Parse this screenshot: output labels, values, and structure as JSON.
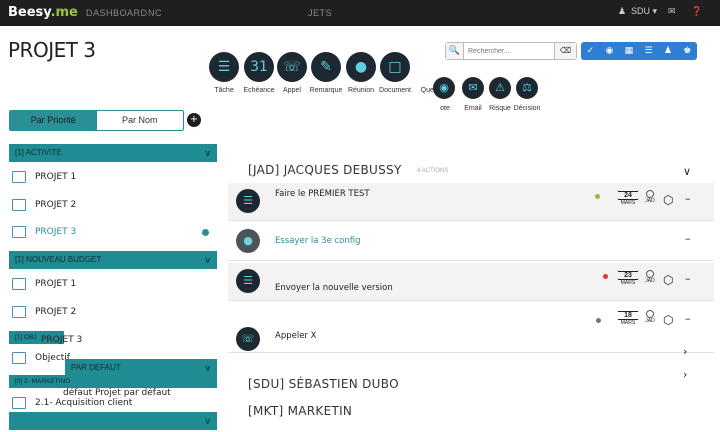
{
  "app": {
    "logo_text": "Beesy",
    "logo_suffix": ".me",
    "nav": [
      "DASHBOARD",
      "NC",
      "JETS"
    ],
    "user": "SDU ▾"
  },
  "page": {
    "title": "PROJET 3"
  },
  "search": {
    "placeholder": "Rechercher..."
  },
  "tools": {
    "top": [
      {
        "label": "Tâche",
        "icon": "task-icon"
      },
      {
        "label": "Echéance",
        "icon": "deadline-icon"
      },
      {
        "label": "Appel",
        "icon": "phone-icon"
      },
      {
        "label": "Remarque",
        "icon": "note-icon"
      },
      {
        "label": "Réunion",
        "icon": "meeting-icon"
      },
      {
        "label": "Document",
        "icon": "document-icon"
      },
      {
        "label": "Ques",
        "icon": "question-icon"
      }
    ],
    "bottom": [
      {
        "label": "ote",
        "icon": "camera-icon"
      },
      {
        "label": "Email",
        "icon": "email-icon"
      },
      {
        "label": "Risque",
        "icon": "risk-icon"
      },
      {
        "label": "Décision",
        "icon": "decision-icon"
      }
    ]
  },
  "sidebar": {
    "toggle": {
      "left": "Par Priorité",
      "right": "Par Nom"
    },
    "groups": [
      {
        "label": "[1] ACTIVITE"
      },
      {
        "label": "[1] NOUVEAU BUDGET"
      },
      {
        "label": "[1] OBJ"
      },
      {
        "label": "PAR DEFAUT"
      },
      {
        "label": "[0] 2- MARKETING"
      }
    ],
    "items": [
      {
        "label": "PROJET 1"
      },
      {
        "label": "PROJET 2"
      },
      {
        "label": "PROJET 3"
      },
      {
        "label": "PROJET 1"
      },
      {
        "label": "PROJET 2"
      },
      {
        "label": "PROJET 3"
      },
      {
        "label": "Objectif"
      },
      {
        "label": "défaut Projet par défaut"
      },
      {
        "label": "2.1- Acquisition client"
      }
    ]
  },
  "main": {
    "sections": [
      {
        "title": "[JAD] JACQUES DEBUSSY",
        "count": "4 ACTIONS"
      },
      {
        "title": "[SDU] SÉBASTIEN DUBO"
      },
      {
        "title": "[MKT] MARKETIN"
      }
    ],
    "rows": [
      {
        "title": "Faire le PREMIER TEST",
        "day": "24",
        "month": "MARS",
        "who": "JAD"
      },
      {
        "title": "Essayer la 3e config"
      },
      {
        "title": "Envoyer la nouvelle version",
        "day": "23",
        "month": "MARS",
        "who": "JAD"
      },
      {
        "title": "Appeler X",
        "day": "18",
        "month": "MARS",
        "who": "JAD"
      }
    ]
  },
  "colors": {
    "accent": "#2a8f96",
    "toolbar": "#2e7fd1",
    "topbar": "#1f1f1f"
  }
}
